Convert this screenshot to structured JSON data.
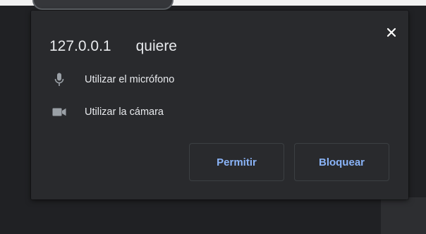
{
  "prompt": {
    "origin": "127.0.0.1",
    "verb": "quiere",
    "permissions": [
      {
        "icon": "microphone-icon",
        "label": "Utilizar el micrófono"
      },
      {
        "icon": "camera-icon",
        "label": "Utilizar la cámara"
      }
    ],
    "allow_label": "Permitir",
    "block_label": "Bloquear"
  },
  "colors": {
    "dialog_bg": "#292a2d",
    "page_bg": "#202124",
    "text": "#e8eaed",
    "icon": "#9aa0a6",
    "accent": "#8ab4f8"
  }
}
